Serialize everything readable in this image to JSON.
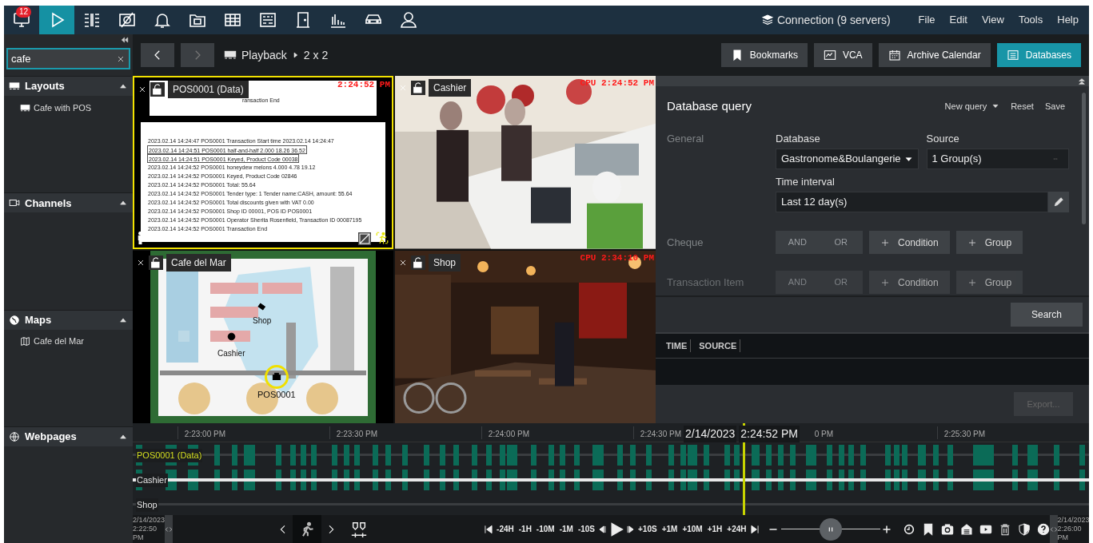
{
  "top_bar": {
    "tabs": [
      {
        "kind": "monitor",
        "selected": false,
        "badge": "12"
      },
      {
        "kind": "playback",
        "selected": true
      },
      {
        "kind": "layouts",
        "selected": false
      },
      {
        "kind": "ptz",
        "selected": false
      },
      {
        "kind": "events",
        "selected": false
      },
      {
        "kind": "archive",
        "selected": false
      },
      {
        "kind": "grid",
        "selected": false
      },
      {
        "kind": "keypad",
        "selected": false
      },
      {
        "kind": "door",
        "selected": false
      },
      {
        "kind": "charts",
        "selected": false
      },
      {
        "kind": "car",
        "selected": false
      },
      {
        "kind": "person",
        "selected": false
      }
    ],
    "connection": "Connection (9 servers)",
    "menu": [
      "File",
      "Edit",
      "View",
      "Tools",
      "Help"
    ]
  },
  "sidebar": {
    "search": {
      "value": "cafe"
    },
    "sections": [
      {
        "title": "Layouts",
        "kind": "layouts",
        "expanded": true,
        "items": [
          {
            "label": "Cafe with POS",
            "kind": "layout"
          }
        ]
      },
      {
        "title": "Channels",
        "kind": "channels",
        "expanded": true
      },
      {
        "title": "Maps",
        "kind": "maps",
        "expanded": true,
        "items": [
          {
            "label": "Cafe del Mar",
            "kind": "map"
          }
        ]
      },
      {
        "title": "Webpages",
        "kind": "webpages",
        "expanded": true
      }
    ]
  },
  "toolbar": {
    "back": {
      "disabled": false
    },
    "forward": {
      "disabled": true
    },
    "breadcrumb": [
      "Playback",
      "2 x 2"
    ],
    "buttons": [
      {
        "label": "Bookmarks",
        "kind": "bookmarks",
        "selected": false
      },
      {
        "label": "VCA",
        "kind": "vca",
        "selected": false
      },
      {
        "label": "Archive Calendar",
        "kind": "calendar",
        "selected": false
      },
      {
        "label": "Databases",
        "kind": "database",
        "selected": true
      }
    ]
  },
  "tiles": [
    {
      "kind": "pos",
      "title": "POS0001 (Data)",
      "selected": true,
      "timestamp": "2:24:52 PM",
      "top_line": "ransaction End",
      "lines": [
        {
          "text": "2023.02.14 14:24:47 POS0001 Transaction Start time 2023.02.14 14:24:47",
          "boxed": false
        },
        {
          "text": "2023.02.14 14:24:51 POS0001 half-and-half 2.000 18.26 36.52",
          "boxed": true
        },
        {
          "text": "2023.02.14 14:24:51 POS0001 Keyed, Product Code 00038",
          "boxed": true
        },
        {
          "text": "2023.02.14 14:24:52 POS0001 honeydew melons 4.000 4.78 19.12",
          "boxed": false
        },
        {
          "text": "2023.02.14 14:24:52 POS0001 Keyed, Product Code 02846",
          "boxed": false
        },
        {
          "text": "2023.02.14 14:24:52 POS0001 Total: 55.64",
          "boxed": false
        },
        {
          "text": "2023.02.14 14:24:52 POS0001 Tender type: 1 Tender name:CASH, amount: 55.64",
          "boxed": false
        },
        {
          "text": "2023.02.14 14:24:52 POS0001 Total discounts given with VAT 0.00",
          "boxed": false
        },
        {
          "text": "2023.02.14 14:24:52 POS0001 Shop ID 00001, POS ID POS0001",
          "boxed": false
        },
        {
          "text": "2023.02.14 14:24:52 POS0001 Operator Sherita Rosenfield, Transaction ID 00087195",
          "boxed": false
        },
        {
          "text": "2023.02.14 14:24:52 POS0001 Transaction End",
          "boxed": false
        }
      ]
    },
    {
      "kind": "counter",
      "title": "Cashier",
      "selected": false,
      "timestamp": "CPU 2:24:52 PM"
    },
    {
      "kind": "map",
      "title": "Cafe del Mar",
      "selected": false,
      "labels": [
        "Shop",
        "Cashier",
        "POS0001"
      ]
    },
    {
      "kind": "storefront",
      "title": "Shop",
      "selected": false,
      "timestamp": "CPU 2:34:10 PM"
    }
  ],
  "query": {
    "title": "Database query",
    "actions": [
      {
        "label": "New query",
        "kind": "dropdown"
      },
      {
        "label": "Reset",
        "kind": "plain"
      },
      {
        "label": "Save",
        "kind": "plain"
      }
    ],
    "general": {
      "label": "General",
      "database": {
        "label": "Database",
        "value": "Gastronome&Boulangerie"
      },
      "source": {
        "label": "Source",
        "value": "1 Group(s)"
      },
      "time_interval": {
        "label": "Time interval",
        "value": "Last 12 day(s)"
      }
    },
    "filters": [
      {
        "label": "Cheque",
        "dimmed": false,
        "operators": [
          {
            "label": "AND",
            "disabled": true
          },
          {
            "label": "OR",
            "disabled": true
          }
        ],
        "buttons": [
          "Condition",
          "Group"
        ]
      },
      {
        "label": "Transaction Item",
        "dimmed": true,
        "operators": [
          {
            "label": "AND",
            "disabled": true
          },
          {
            "label": "OR",
            "disabled": true
          }
        ],
        "buttons": [
          "Condition",
          "Group"
        ]
      }
    ],
    "search_button": "Search",
    "columns": [
      "TIME",
      "SOURCE"
    ],
    "export": {
      "label": "Export...",
      "disabled": true
    }
  },
  "timeline": {
    "ticks": [
      "2:23:00 PM",
      "2:23:30 PM",
      "2:24:00 PM",
      "2:24:30 PM",
      "0 PM",
      "2:25:30 PM"
    ],
    "cursor": {
      "date": "2/14/2023",
      "time": "2:24:52 PM"
    },
    "tracks": [
      {
        "label": "POS0001 (Data)",
        "selected": true,
        "has_records": true,
        "playing": false
      },
      {
        "label": "Cashier",
        "selected": false,
        "has_records": true,
        "playing": true
      },
      {
        "label": "Shop",
        "selected": false,
        "has_records": false,
        "playing": false
      }
    ]
  },
  "controls": {
    "range_start": {
      "date": "2/14/2023",
      "time": "2:22:50 PM"
    },
    "range_end": {
      "date": "2/14/2023",
      "time": "2:26:00 PM"
    },
    "motion_filter": {
      "on": true
    },
    "jump_back": [
      "-24H",
      "-1H",
      "-10M",
      "-1M",
      "-10S"
    ],
    "jump_forward": [
      "+10S",
      "+1M",
      "+10M",
      "+1H",
      "+24H"
    ],
    "speed": {
      "level": 0.5
    }
  }
}
